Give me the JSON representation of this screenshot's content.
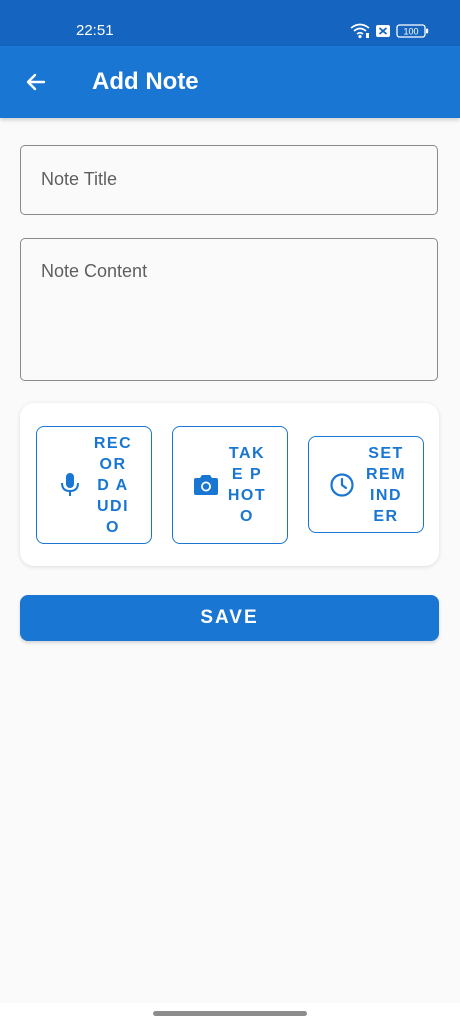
{
  "status_bar": {
    "time": "22:51",
    "battery": "100",
    "icons": [
      "wifi-icon",
      "notification-x-icon",
      "battery-icon"
    ]
  },
  "app_bar": {
    "title": "Add Note",
    "back_icon": "arrow-left-icon"
  },
  "form": {
    "title_placeholder": "Note Title",
    "title_value": "",
    "content_placeholder": "Note Content",
    "content_value": ""
  },
  "actions": [
    {
      "label": "RECORD AUDIO",
      "icon": "microphone-icon"
    },
    {
      "label": "TAKE PHOTO",
      "icon": "camera-icon"
    },
    {
      "label": "SET REMINDER",
      "icon": "clock-icon"
    }
  ],
  "save_label": "SAVE",
  "colors": {
    "primary": "#1976d2",
    "status_bar": "#1565c0",
    "background": "#fafafa"
  }
}
